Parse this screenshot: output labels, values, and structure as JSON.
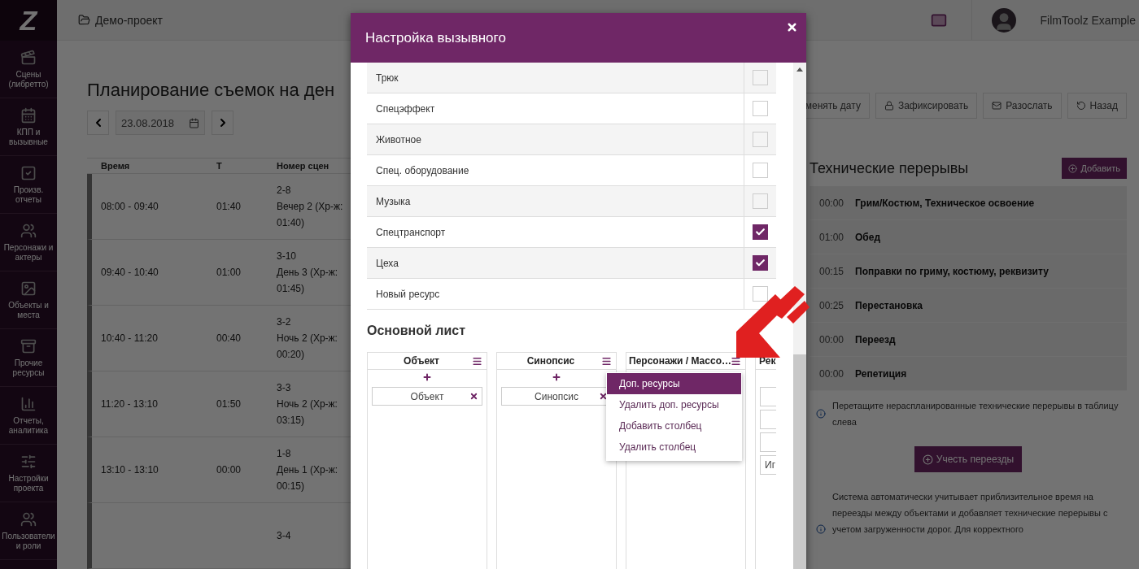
{
  "sidebar": {
    "logo": "Z",
    "items": [
      {
        "label": "Сцены (либретто)"
      },
      {
        "label": "КПП и вызывные"
      },
      {
        "label": "Произв. отчеты"
      },
      {
        "label": "Персонажи и актеры"
      },
      {
        "label": "Объекты и места"
      },
      {
        "label": "Прочие ресурсы"
      },
      {
        "label": "Отчеты, аналитика"
      },
      {
        "label": "Настройки проекта"
      },
      {
        "label": "Пользователи и роли"
      }
    ]
  },
  "header": {
    "project": "Демо-проект",
    "user": "FilmToolz Example"
  },
  "page": {
    "title": "Планирование съемок на ден",
    "date": "23.08.2018",
    "actions": [
      {
        "label": "менять дату"
      },
      {
        "label": "Зафиксировать"
      },
      {
        "label": "Разослать"
      },
      {
        "label": "Назад"
      }
    ]
  },
  "schedule": {
    "columns": [
      "Время",
      "Т",
      "Номер сцен"
    ],
    "rows": [
      {
        "time": "08:00 - 09:40",
        "duration": "01:40",
        "scene": "2-8",
        "detail": "Вечер 2 (Хр-ж: 01:40)"
      },
      {
        "time": "09:40 - 10:40",
        "duration": "01:00",
        "scene": "3-10",
        "detail": "День 3 (Хр-ж: 01:45)"
      },
      {
        "time": "10:40 - 11:20",
        "duration": "00:40",
        "scene": "3-2",
        "detail": "Ночь 2 (Хр-ж: 00:20)"
      },
      {
        "time": "11:20 - 13:10",
        "duration": "01:50",
        "scene": "3-3",
        "detail": "Ночь 2 (Хр-ж: 03:15)"
      },
      {
        "time": "13:10 - 13:10",
        "duration": "00:00",
        "scene": "1-8",
        "detail": "День 1 (Хр-ж: 00:15)"
      },
      {
        "scene": "3-4"
      }
    ]
  },
  "breaks": {
    "title": "Технические перерывы",
    "add_button": "Добавить",
    "items": [
      {
        "time": "00:00",
        "name": "Грим/Костюм, Техническое освоение"
      },
      {
        "time": "01:00",
        "name": "Обед"
      },
      {
        "time": "00:15",
        "name": "Поправки по гриму, костюму, реквизиту"
      },
      {
        "time": "00:25",
        "name": "Перестановка"
      },
      {
        "time": "00:00",
        "name": "Переезд"
      },
      {
        "time": "00:00",
        "name": "Репетиция"
      }
    ],
    "hint": "Перетащите нераспланированные технические перерывы в таблицу слева",
    "moves_button": "Учесть переезды",
    "note": "Система автоматически учитывает приблизительное время на переезды между объектами и добавляет технические перерывы с учетом загруженности дорог. Для корректного"
  },
  "modal": {
    "title": "Настройка вызывного",
    "resources": [
      {
        "label": "Трюк",
        "checked": false
      },
      {
        "label": "Спецэффект",
        "checked": false
      },
      {
        "label": "Животное",
        "checked": false
      },
      {
        "label": "Спец. оборудование",
        "checked": false
      },
      {
        "label": "Музыка",
        "checked": false
      },
      {
        "label": "Спецтранспорт",
        "checked": true
      },
      {
        "label": "Цеха",
        "checked": true
      },
      {
        "label": "Новый ресурс",
        "checked": false
      }
    ],
    "section_title": "Основной лист",
    "columns": [
      {
        "title": "Объект",
        "items": [
          {
            "kind": "tag",
            "label": "Объект"
          }
        ]
      },
      {
        "title": "Синопсис",
        "items": [
          {
            "kind": "tag",
            "label": "Синопсис"
          }
        ]
      },
      {
        "title": "Персонажи / Массо…"
      },
      {
        "title": "Рек",
        "items": [
          {
            "kind": "blank"
          },
          {
            "kind": "blank"
          },
          {
            "kind": "blank"
          },
          {
            "kind": "text",
            "label": "Иг"
          }
        ]
      }
    ],
    "menu": {
      "items": [
        {
          "label": "Доп. ресурсы",
          "selected": true
        },
        {
          "label": "Удалить доп. ресурсы",
          "selected": false
        },
        {
          "label": "Добавить столбец",
          "selected": false
        },
        {
          "label": "Удалить столбец",
          "selected": false
        }
      ]
    }
  }
}
